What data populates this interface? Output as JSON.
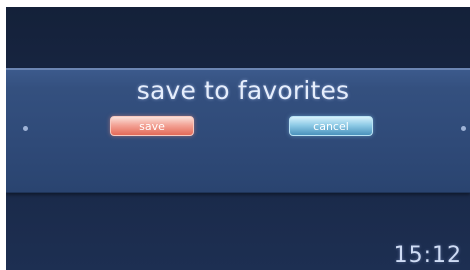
{
  "dialog": {
    "title": "save to favorites",
    "save_label": "save",
    "cancel_label": "cancel"
  },
  "status": {
    "clock": "15:12"
  },
  "colors": {
    "background": "#1a2a4a",
    "dialog_band": "#34507f",
    "save_button": "#ef8f80",
    "cancel_button": "#7ab8da"
  }
}
